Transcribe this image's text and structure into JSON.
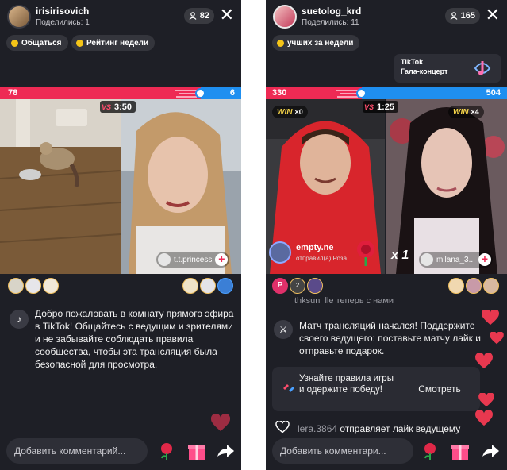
{
  "left": {
    "host": {
      "name": "irisirisovich",
      "subtitle": "Поделились: 1"
    },
    "viewers": "82",
    "pills": [
      "Общаться",
      "Рейтинг недели"
    ],
    "score": {
      "left": "78",
      "right": "6",
      "fraction": 0.93
    },
    "timer": "3:50",
    "guest_tag": "t.t.princess",
    "welcome": "Добро пожаловать в комнату прямого эфира в TikTok! Общайтесь с ведущим и зрителями и не забывайте соблюдать правила сообщества, чтобы эта трансляция была безопасной для просмотра.",
    "comment_placeholder": "Добавить комментарий..."
  },
  "right": {
    "host": {
      "name": "suetolog_krd",
      "subtitle": "Поделились: 11"
    },
    "viewers": "165",
    "pill": "учших за недели",
    "gala": {
      "line1": "TikTok",
      "line2": "Гала-концерт"
    },
    "score": {
      "left": "330",
      "right": "504",
      "fraction": 0.396
    },
    "timer": "1:25",
    "win_left": {
      "label": "WIN",
      "mult": "×0"
    },
    "win_right": {
      "label": "WIN",
      "mult": "×4"
    },
    "gift_sender": {
      "name": "empty.ne",
      "text": "отправил(а) Роза"
    },
    "combo": "x 1",
    "guest_tag": "milana_3...",
    "avatar_badges": {
      "first": "P",
      "second": "2"
    },
    "chat_partial": "thksun_lle теперь с нами",
    "battle_msg": "Матч трансляций начался! Поддержите своего ведущего: поставьте матчу лайк и отправьте подарок.",
    "rules_text": "Узнайте правила игры и одержите победу!",
    "rules_button": "Смотреть",
    "like_user": "lera.3864",
    "like_text": " отправляет лайк ведущему",
    "comment_placeholder": "Добавить комментари..."
  },
  "colors": {
    "red": "#ee2a54",
    "blue": "#1f8ff0",
    "bg": "#1e1f26"
  }
}
